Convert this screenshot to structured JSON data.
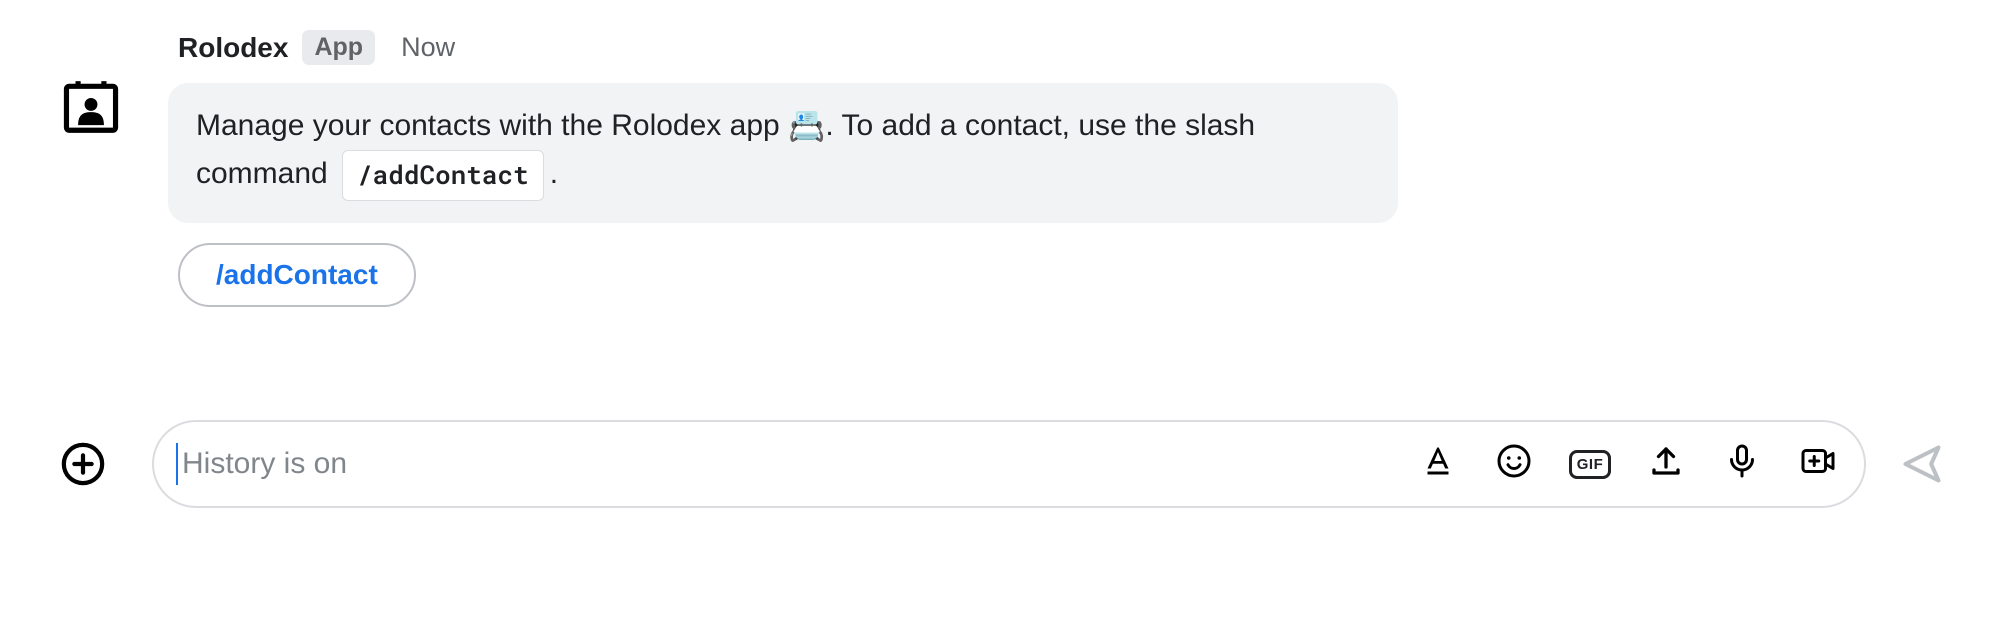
{
  "message": {
    "author": "Rolodex",
    "app_badge": "App",
    "timestamp": "Now",
    "body_part1": "Manage your contacts with the Rolodex app ",
    "emoji": "📇",
    "body_part2": ". To add a contact, use the slash command ",
    "slash_command_code": "/addContact",
    "body_part3": ".",
    "chip_label": "/addContact"
  },
  "composer": {
    "placeholder": "History is on",
    "gif_label": "GIF"
  }
}
